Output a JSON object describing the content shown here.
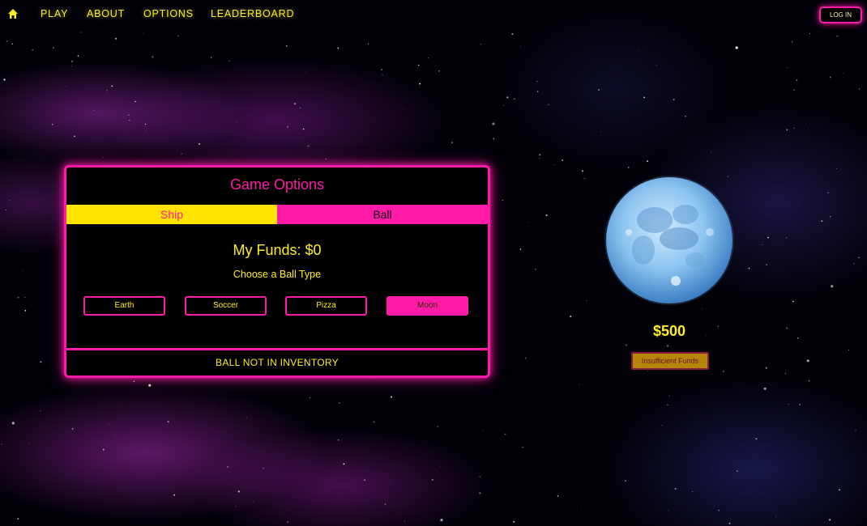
{
  "nav": {
    "home_icon": "home-icon",
    "links": [
      "PLAY",
      "ABOUT",
      "OPTIONS",
      "LEADERBOARD"
    ],
    "login_label": "LOG IN"
  },
  "options_panel": {
    "title": "Game Options",
    "tabs": [
      {
        "label": "Ship",
        "active": false
      },
      {
        "label": "Ball",
        "active": true
      }
    ],
    "funds_text": "My Funds: $0",
    "prompt": "Choose a Ball Type",
    "ball_types": [
      {
        "label": "Earth",
        "selected": false
      },
      {
        "label": "Soccer",
        "selected": false
      },
      {
        "label": "Pizza",
        "selected": false
      },
      {
        "label": "Moon",
        "selected": true
      }
    ],
    "status": "BALL NOT IN INVENTORY"
  },
  "preview": {
    "ball_icon": "moon-icon",
    "price": "$500",
    "action_label": "Insufficient Funds"
  },
  "colors": {
    "accent_pink": "#ff1aa8",
    "accent_yellow": "#ffee22",
    "background": "#020108"
  }
}
